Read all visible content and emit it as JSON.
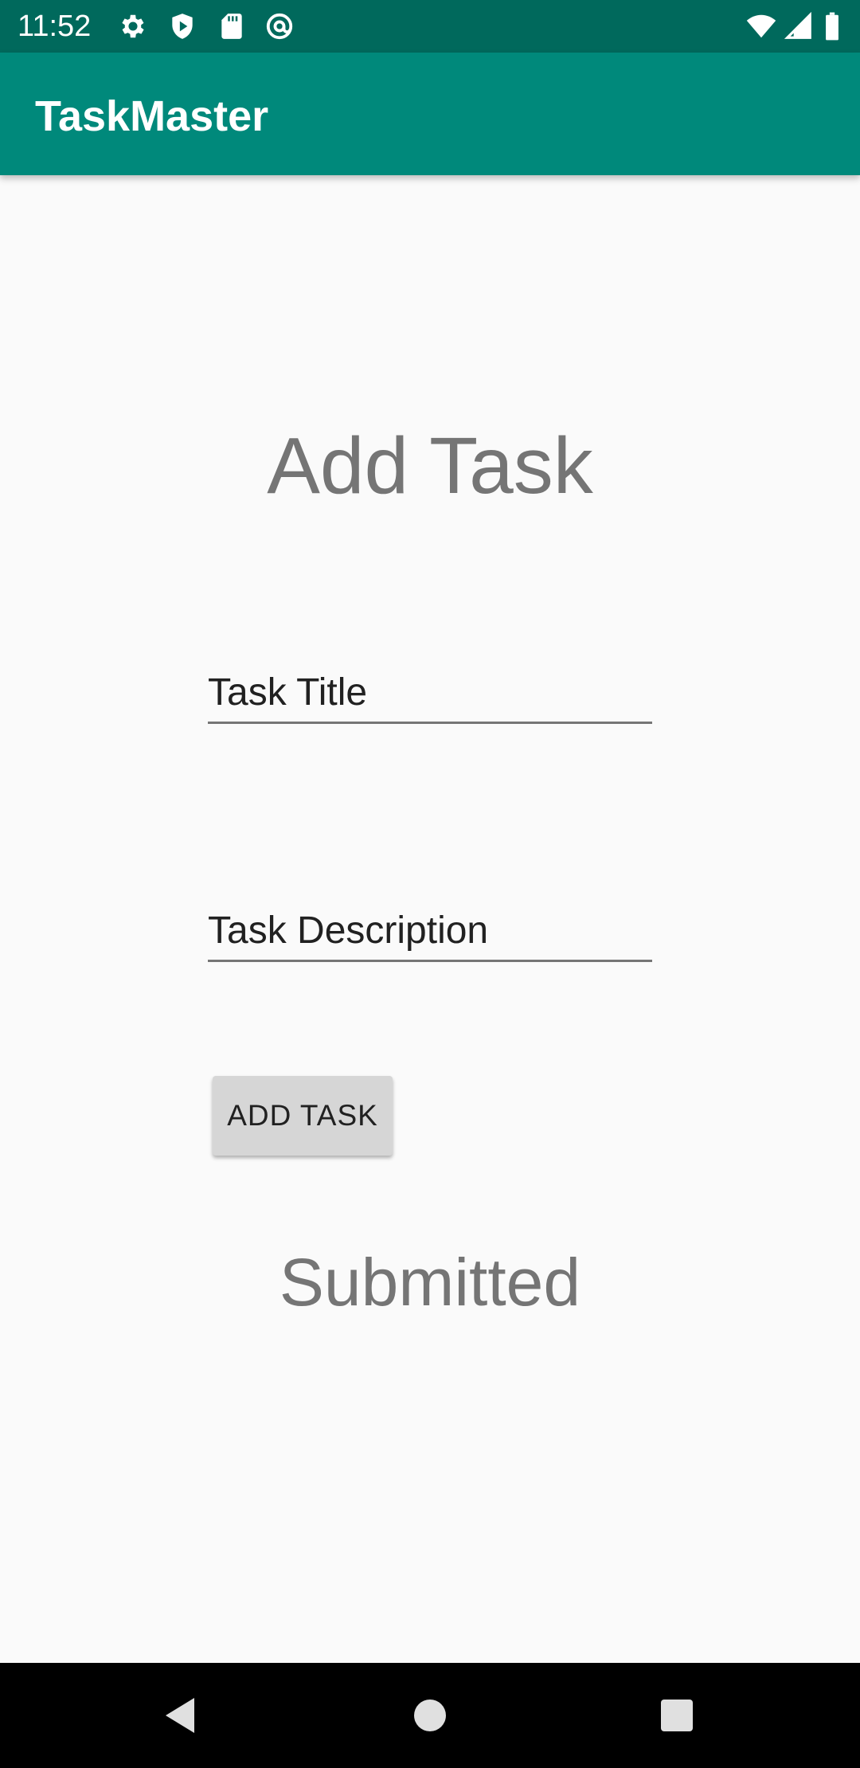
{
  "status_bar": {
    "time": "11:52",
    "left_icons": [
      "settings-icon",
      "shield-icon",
      "sd-card-icon",
      "at-sign-icon"
    ],
    "right_icons": [
      "wifi-icon",
      "cell-signal-icon",
      "battery-icon"
    ]
  },
  "app_bar": {
    "title": "TaskMaster",
    "color": "#00897b",
    "status_color": "#00695c"
  },
  "form": {
    "heading": "Add Task",
    "task_title_field": {
      "value": "Task Title"
    },
    "task_description_field": {
      "value": "Task Description"
    },
    "add_button_label": "ADD TASK",
    "status_text": "Submitted"
  },
  "nav_bar": {
    "buttons": [
      "back-icon",
      "home-icon",
      "recents-icon"
    ]
  }
}
